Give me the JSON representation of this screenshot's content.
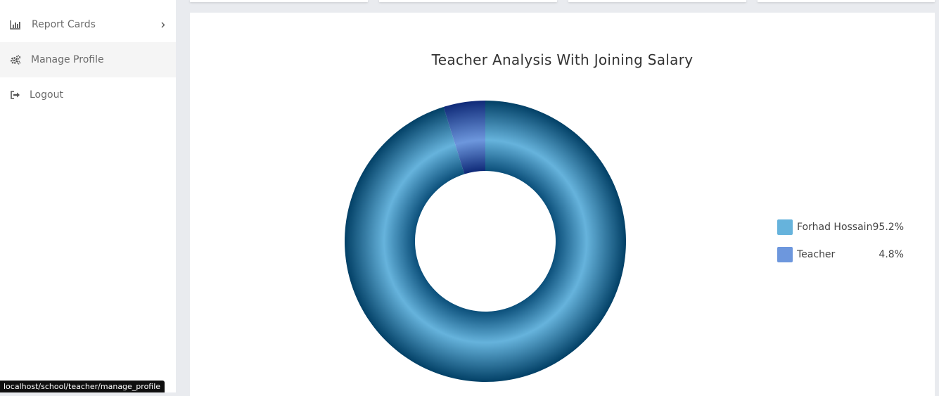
{
  "sidebar": {
    "items": [
      {
        "label": "Report Cards",
        "icon": "bar-chart-icon",
        "has_chevron": true
      },
      {
        "label": "Manage Profile",
        "icon": "gears-icon",
        "active": true
      },
      {
        "label": "Logout",
        "icon": "sign-out-icon"
      }
    ]
  },
  "chart_data": {
    "type": "pie",
    "title": "Teacher Analysis With Joining Salary",
    "donut": true,
    "legend_position": "right",
    "categories": [
      "Forhad Hossain",
      "Teacher"
    ],
    "values": [
      95.2,
      4.8
    ],
    "labels": [
      "95.2%",
      "4.8%"
    ],
    "colors": [
      "#66b3dc",
      "#6d97dd"
    ]
  },
  "status_bar": {
    "url": "localhost/school/teacher/manage_profile"
  }
}
